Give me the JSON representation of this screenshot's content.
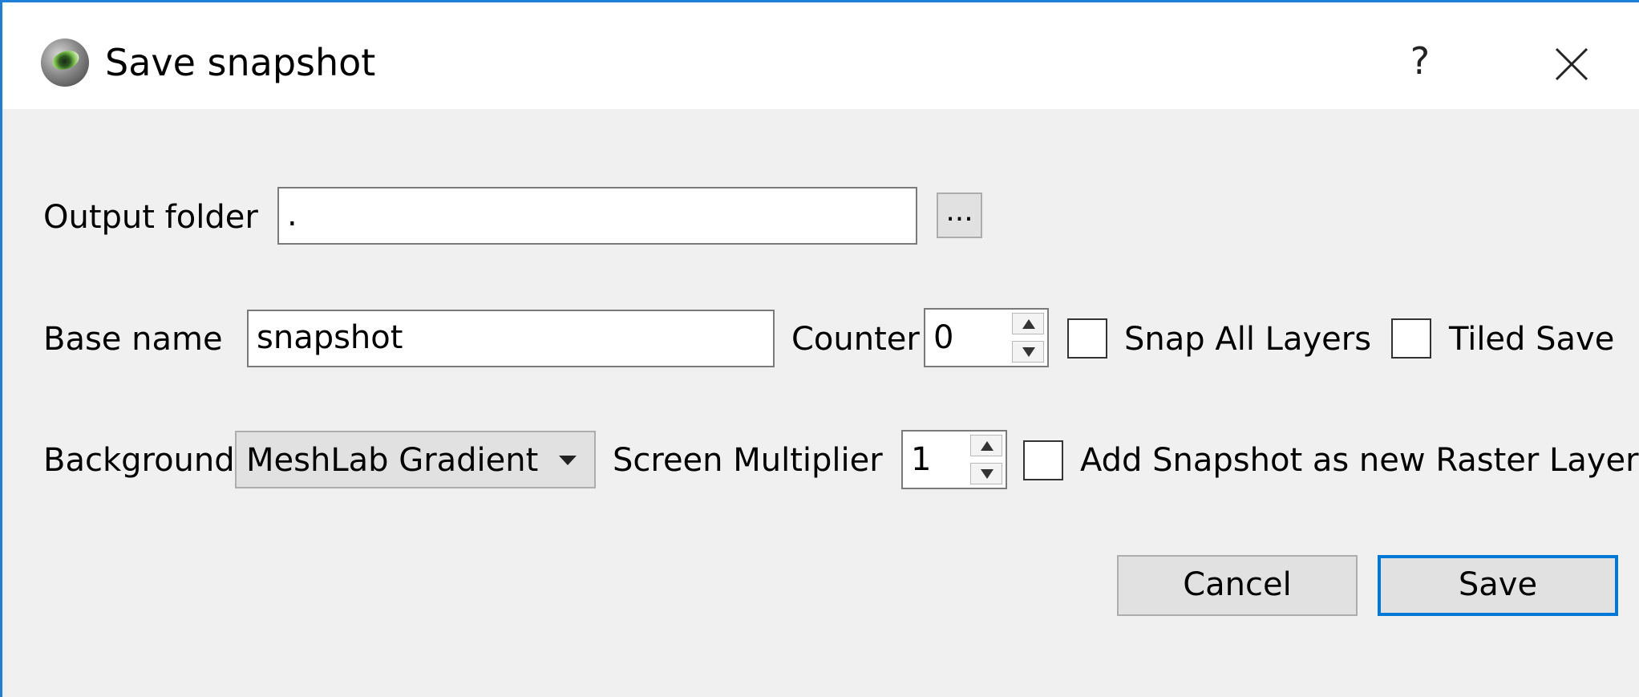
{
  "window": {
    "title": "Save snapshot",
    "help_label": "?"
  },
  "icons": {
    "app": "meshlab-eye-icon",
    "close": "close-icon",
    "dropdown": "chevron-down-icon",
    "spin_up": "spin-up-icon",
    "spin_down": "spin-down-icon"
  },
  "form": {
    "output_folder": {
      "label": "Output folder",
      "value": ".",
      "browse_label": "..."
    },
    "base_name": {
      "label": "Base name",
      "value": "snapshot"
    },
    "counter": {
      "label": "Counter",
      "value": "0"
    },
    "snap_all_layers": {
      "label": "Snap All Layers",
      "checked": false
    },
    "tiled_save": {
      "label": "Tiled Save",
      "checked": false
    },
    "background": {
      "label": "Background",
      "selected": "MeshLab Gradient"
    },
    "screen_multiplier": {
      "label": "Screen Multiplier",
      "value": "1"
    },
    "add_raster_layer": {
      "label": "Add Snapshot as new Raster Layer",
      "checked": false
    }
  },
  "buttons": {
    "cancel": "Cancel",
    "save": "Save"
  },
  "colors": {
    "accent": "#0078d7",
    "window_border": "#1e7ed8",
    "dialog_bg": "#f0f0f0",
    "titlebar_bg": "#ffffff"
  }
}
